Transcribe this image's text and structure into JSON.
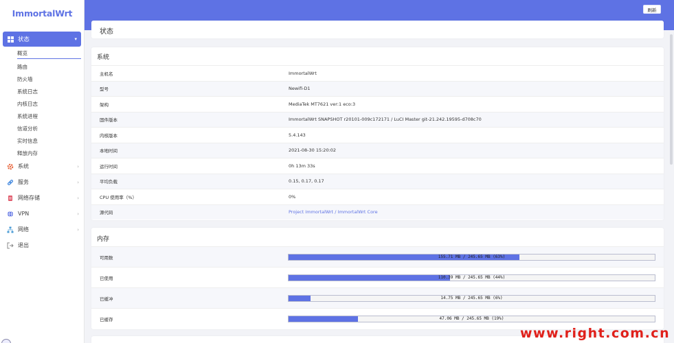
{
  "sidebar": {
    "logo": "ImmortalWrt",
    "active_menu": "状态",
    "submenu": [
      "概览",
      "路由",
      "防火墙",
      "系统日志",
      "内核日志",
      "系统进程",
      "信道分析",
      "实时信息",
      "释放内存"
    ],
    "items": [
      {
        "label": "系统",
        "icon": "gear-icon",
        "color": "#e8663d"
      },
      {
        "label": "服务",
        "icon": "link-icon",
        "color": "#4a8de0"
      },
      {
        "label": "网络存储",
        "icon": "storage-icon",
        "color": "#e05a6b"
      },
      {
        "label": "VPN",
        "icon": "globe-icon",
        "color": "#5e72e4"
      },
      {
        "label": "网络",
        "icon": "network-icon",
        "color": "#4a9bd5"
      },
      {
        "label": "退出",
        "icon": "logout-icon",
        "color": "#888888"
      }
    ]
  },
  "header": {
    "refresh_label": "刷新"
  },
  "page": {
    "title": "状态"
  },
  "system": {
    "title": "系统",
    "rows": [
      {
        "key": "主机名",
        "value": "ImmortalWrt"
      },
      {
        "key": "型号",
        "value": "Newifi-D1"
      },
      {
        "key": "架构",
        "value": "MediaTek MT7621 ver:1 eco:3"
      },
      {
        "key": "固件版本",
        "value": "ImmortalWrt SNAPSHOT r20101-009c172171 / LuCI Master git-21.242.19595-d708c70"
      },
      {
        "key": "内核版本",
        "value": "5.4.143"
      },
      {
        "key": "本地时间",
        "value": "2021-08-30 15:20:02"
      },
      {
        "key": "运行时间",
        "value": "0h 13m 33s"
      },
      {
        "key": "平均负载",
        "value": "0.15, 0.17, 0.17"
      },
      {
        "key": "CPU 使用率（%）",
        "value": "0%"
      },
      {
        "key": "源代码",
        "value": "Project ImmortalWrt / ImmortalWrt Core"
      }
    ]
  },
  "memory": {
    "title": "内存",
    "rows": [
      {
        "key": "可用数",
        "text": "155.71 MB / 245.65 MB (63%)",
        "percent": 63
      },
      {
        "key": "已使用",
        "text": "110.39 MB / 245.65 MB (44%)",
        "percent": 44
      },
      {
        "key": "已缓冲",
        "text": "14.75 MB / 245.65 MB (6%)",
        "percent": 6
      },
      {
        "key": "已缓存",
        "text": "47.06 MB / 245.65 MB (19%)",
        "percent": 19
      }
    ]
  },
  "colors": {
    "accent": "#5e72e4",
    "watermark": "#e0201a"
  },
  "watermark": "www.right.com.cn"
}
